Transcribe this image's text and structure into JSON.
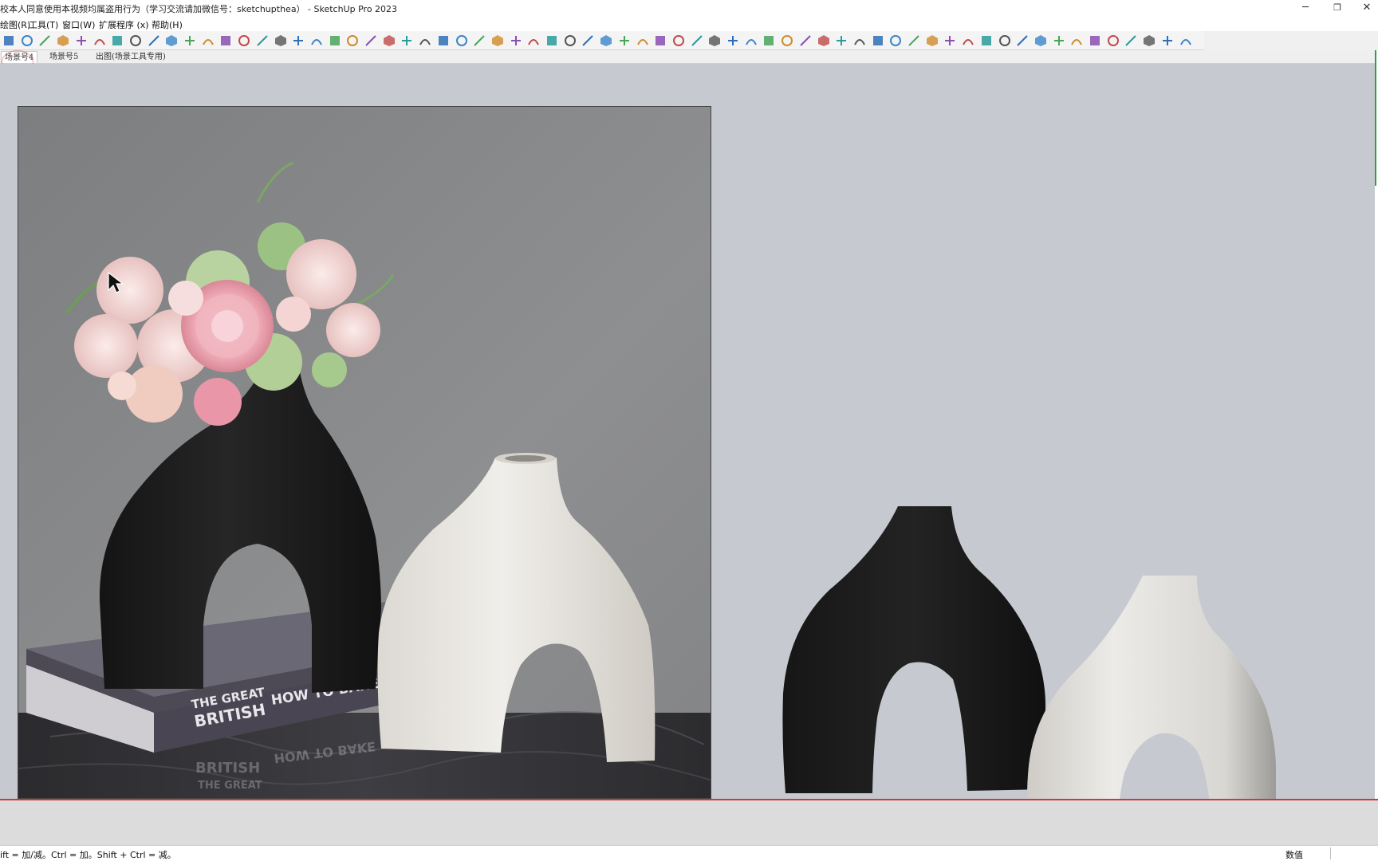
{
  "window": {
    "title": "校本人同意使用本视频均属盗用行为（学习交流请加微信号：sketchupthea） - SketchUp Pro 2023",
    "controls": {
      "minimize": "─",
      "restore": "❐",
      "close": "✕"
    }
  },
  "menu": {
    "items": [
      {
        "label": "绘图(R)"
      },
      {
        "label": "工具(T)"
      },
      {
        "label": "窗口(W)"
      },
      {
        "label": "扩展程序 (x)"
      },
      {
        "label": "帮助(H)"
      }
    ]
  },
  "toolbar": {
    "icons": [
      "pencil-icon",
      "layout-icon",
      "sandbox-icon",
      "sphere-icon",
      "box-icon",
      "spiral-icon",
      "select-icon",
      "move-icon",
      "rotate-icon",
      "scale-icon",
      "tape-measure-icon",
      "component-icon",
      "cube-icon",
      "cube-grid-icon",
      "shield-icon",
      "paint-bucket-icon",
      "gear-icon",
      "curve-icon",
      "line-icon",
      "intersect-icon",
      "axes-icon",
      "dimension-icon",
      "square-icon",
      "diagonal-box-icon",
      "lines-icon",
      "minus-icon",
      "align-center-icon",
      "align-top-icon",
      "trim-icon",
      "grid-icon",
      "grid-blue-icon",
      "grid-blue2-icon",
      "grid-mesh-icon",
      "grid-mesh2-icon",
      "grid-mixed-icon",
      "red-square-icon",
      "photo-texture-icon",
      "eraser-icon",
      "window-icon",
      "arrow-scatter-icon",
      "scatter-icon",
      "diagonal-line-icon",
      "arc-icon",
      "fold-icon",
      "bend-icon",
      "spiral-curve-icon",
      "stair-icon",
      "pipe-icon",
      "dial-icon",
      "star-icon",
      "shield-outline-icon",
      "lock-people-icon",
      "tree-icon",
      "wave-icon",
      "flower-icon",
      "sphere-grid-icon",
      "chart-line-icon",
      "slope-icon",
      "gradient-icon",
      "eye-tilt-icon",
      "eye-tilt2-icon",
      "ribbon-icon",
      "connector-icon",
      "dual-rect-icon",
      "target-icon",
      "close-x-icon"
    ]
  },
  "scenes": {
    "tabs": [
      {
        "label": "场景号4"
      },
      {
        "label": "场景号5"
      },
      {
        "label": "出图(场景工具专用)"
      }
    ]
  },
  "photo": {
    "book_title_line1": "THE GREAT",
    "book_title_line2": "BRITISH",
    "book_subtitle": "HOW TO BAKE",
    "reflection_subtitle": "HOW TO BAKE",
    "reflection_line1": "BRITISH",
    "reflection_line2": "THE GREAT"
  },
  "status": {
    "hint": "ift = 加/减。Ctrl = 加。Shift + Ctrl = 减。",
    "measure_label": "数值",
    "measure_value": ""
  },
  "colors": {
    "viewport_bg": "#c6cad0",
    "black_vase": "#1c1c1c",
    "white_vase": "#e9e6e1",
    "accent_red": "#c83c3c"
  }
}
